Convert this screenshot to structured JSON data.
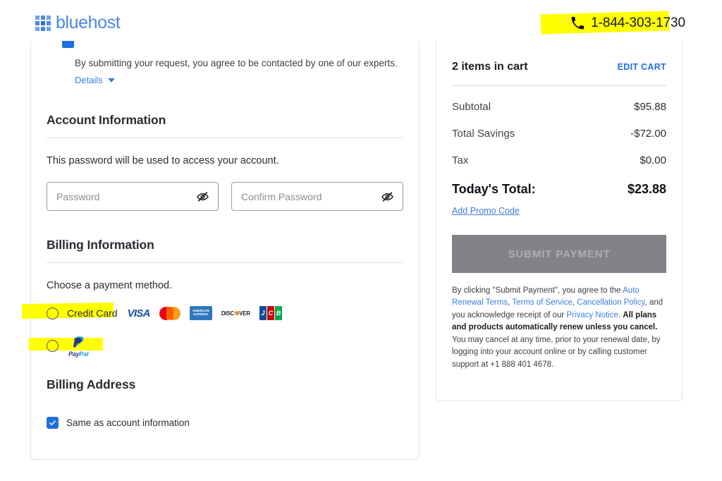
{
  "header": {
    "logo_text": "bluehost",
    "logo_icon": "grid-squares-icon",
    "phone_icon": "phone-icon",
    "phone_number": "1-844-303-1730"
  },
  "form": {
    "consent": {
      "clipped_text": "",
      "note": "By submitting your request, you agree to be contacted by one of our experts.",
      "details_label": "Details",
      "caret_icon": "chevron-down-icon"
    },
    "account": {
      "title": "Account Information",
      "description": "This password will be used to access your account.",
      "password_placeholder": "Password",
      "confirm_placeholder": "Confirm Password",
      "password_value": "",
      "confirm_value": "",
      "toggle_icon": "eye-slash-icon"
    },
    "billing": {
      "title": "Billing Information",
      "prompt": "Choose a payment method.",
      "methods": [
        {
          "label": "Credit Card",
          "selected": false,
          "highlighted": true
        },
        {
          "label": "PayPal",
          "selected": false,
          "highlighted": true
        }
      ],
      "card_brands": [
        {
          "name": "visa-logo",
          "text": "VISA"
        },
        {
          "name": "mastercard-logo",
          "text": ""
        },
        {
          "name": "amex-logo",
          "text": "AMERICAN EXPRESS"
        },
        {
          "name": "discover-logo",
          "text": "DISC VER"
        },
        {
          "name": "jcb-logo",
          "text": "JCB"
        }
      ],
      "paypal_word_a": "Pay",
      "paypal_word_b": "Pal"
    },
    "address": {
      "title": "Billing Address",
      "same_as_account_label": "Same as account information",
      "same_as_account_checked": true,
      "check_icon": "checkmark-icon"
    }
  },
  "cart": {
    "title": "2 items in cart",
    "edit_label": "EDIT CART",
    "lines": [
      {
        "label": "Subtotal",
        "amount": "$95.88"
      },
      {
        "label": "Total Savings",
        "amount": "-$72.00"
      },
      {
        "label": "Tax",
        "amount": "$0.00"
      }
    ],
    "total_label": "Today's Total:",
    "total_amount": "$23.88",
    "promo_label": "Add Promo Code",
    "submit_label": "SUBMIT PAYMENT",
    "legal": {
      "p1": "By clicking \"Submit Payment\", you agree to the ",
      "link1": "Auto Renewal Terms",
      "sep1": ", ",
      "link2": "Terms of Service",
      "sep2": ", ",
      "link3": "Cancellation Policy",
      "p2": ", and you acknowledge receipt of our ",
      "link4": "Privacy Notice",
      "p3": ". ",
      "bold": "All plans and products automatically renew unless you cancel.",
      "p4": " You may cancel at any time, prior to your renewal date, by logging into your account online or by calling customer support at +1 888 401 4678."
    }
  },
  "colors": {
    "brand_blue": "#4a86e8",
    "link_blue": "#3b7ddd",
    "accent_blue": "#1f6fe0",
    "highlight_yellow": "#ffff00",
    "disabled_gray": "#828287"
  }
}
